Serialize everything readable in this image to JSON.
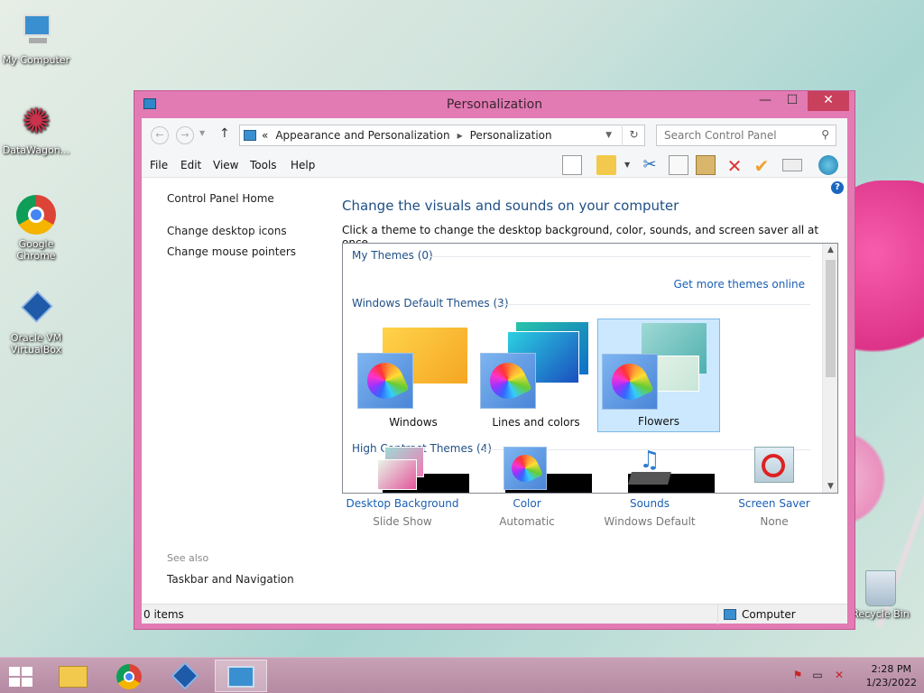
{
  "desktop": {
    "icons": [
      {
        "label": "My Computer"
      },
      {
        "label": "DataWagon..."
      },
      {
        "label": "Google Chrome"
      },
      {
        "label": "Oracle VM VirtualBox"
      },
      {
        "label": "Recycle Bin"
      }
    ]
  },
  "window": {
    "title": "Personalization",
    "controls": {
      "minimize": "—",
      "maximize": "☐",
      "close": "✕"
    }
  },
  "address": {
    "prefix": "«",
    "crumbs": [
      "Appearance and Personalization",
      "Personalization"
    ],
    "separator": "▸",
    "search_placeholder": "Search Control Panel"
  },
  "menu": [
    "File",
    "Edit",
    "View",
    "Tools",
    "Help"
  ],
  "left_pane": {
    "home": "Control Panel Home",
    "links": [
      "Change desktop icons",
      "Change mouse pointers"
    ],
    "see_also_label": "See also",
    "see_also_links": [
      "Taskbar and Navigation"
    ]
  },
  "main": {
    "heading": "Change the visuals and sounds on your computer",
    "subheading": "Click a theme to change the desktop background, color, sounds, and screen saver all at once.",
    "groups": {
      "my_themes": "My Themes (0)",
      "default_themes": "Windows Default Themes (3)",
      "high_contrast": "High Contrast Themes (4)"
    },
    "more_link": "Get more themes online",
    "themes": [
      {
        "label": "Windows",
        "selected": false
      },
      {
        "label": "Lines and colors",
        "selected": false
      },
      {
        "label": "Flowers",
        "selected": true
      }
    ]
  },
  "bottom": [
    {
      "title": "Desktop Background",
      "value": "Slide Show"
    },
    {
      "title": "Color",
      "value": "Automatic"
    },
    {
      "title": "Sounds",
      "value": "Windows Default"
    },
    {
      "title": "Screen Saver",
      "value": "None"
    }
  ],
  "status": {
    "items": "0 items",
    "location": "Computer"
  },
  "taskbar": {
    "time": "2:28 PM",
    "date": "1/23/2022"
  },
  "colors": {
    "accent": "#e27ab3",
    "link": "#1a5fb4",
    "selection": "#cce8ff"
  }
}
